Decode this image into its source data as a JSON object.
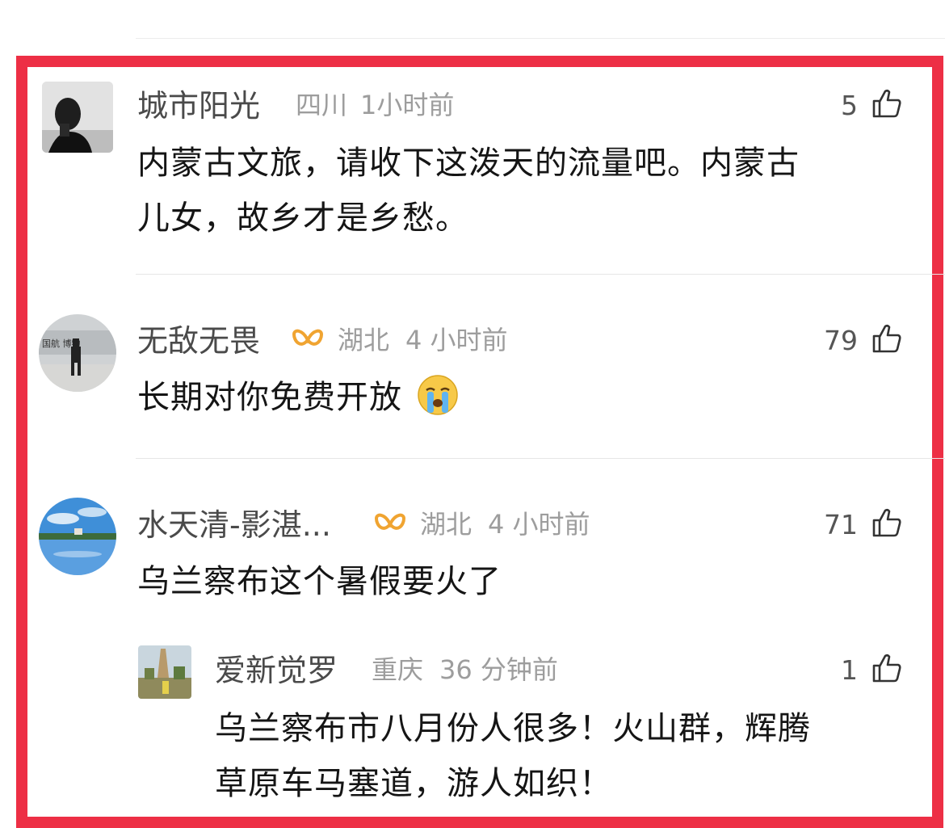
{
  "comments": [
    {
      "username": "城市阳光",
      "location": "四川",
      "time": "1小时前",
      "likes": "5",
      "text_lines": [
        "内蒙古文旅，请收下这泼天的流量吧。内蒙古",
        "儿女，故乡才是乡愁。"
      ]
    },
    {
      "username": "无敌无畏",
      "location": "湖北",
      "time": "4 小时前",
      "likes": "79",
      "text": "长期对你免费开放",
      "emoji": "crying-face-icon"
    },
    {
      "username": "水天清-影湛...",
      "location": "湖北",
      "time": "4 小时前",
      "likes": "71",
      "text": "乌兰察布这个暑假要火了",
      "reply": {
        "username": "爱新觉罗",
        "location": "重庆",
        "time": "36 分钟前",
        "likes": "1",
        "text_lines": [
          "乌兰察布市八月份人很多！火山群，辉腾",
          "草原车马塞道，游人如织！"
        ]
      }
    }
  ],
  "colors": {
    "frame": "#ed2f45",
    "vip_badge": "#f0a431",
    "meta": "#9d9d9d"
  }
}
